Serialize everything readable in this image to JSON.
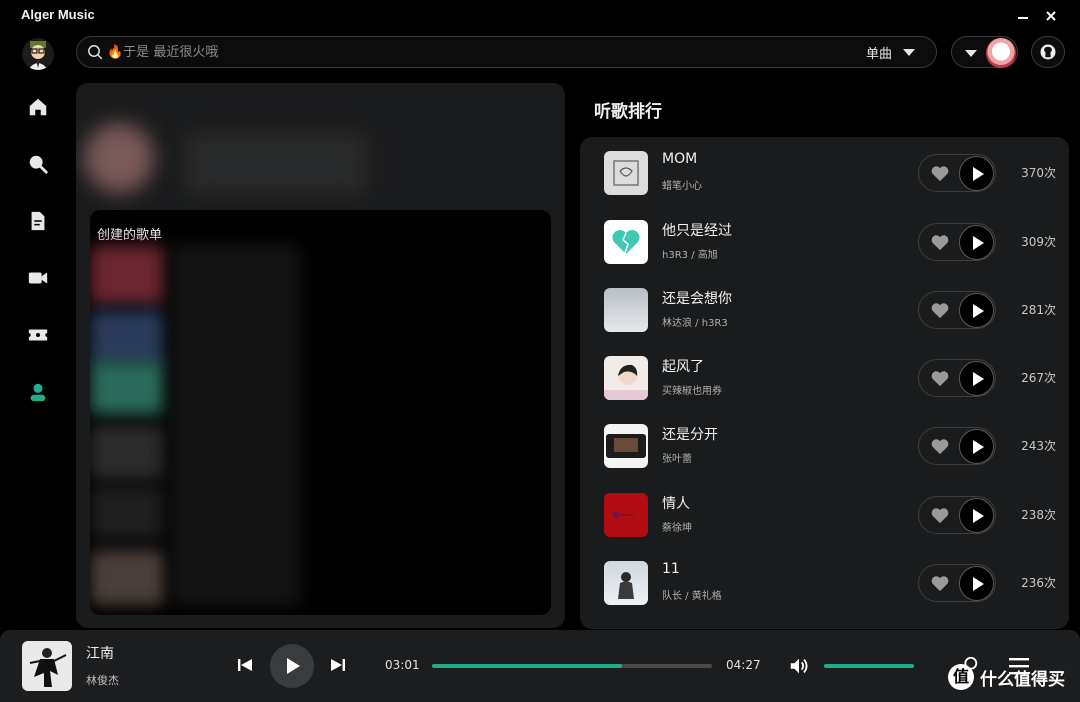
{
  "app": {
    "title": "Alger Music"
  },
  "search": {
    "placeholder": "🔥于是 最近很火哦",
    "type_label": "单曲"
  },
  "left_panel": {
    "playlist_title": "创建的歌单"
  },
  "ranking": {
    "title": "听歌排行",
    "items": [
      {
        "name": "MOM",
        "artist": "蜡笔小心",
        "count": "370次"
      },
      {
        "name": "他只是经过",
        "artist": "h3R3 / 高旭",
        "count": "309次"
      },
      {
        "name": "还是会想你",
        "artist": "林达浪 / h3R3",
        "count": "281次"
      },
      {
        "name": "起风了",
        "artist": "买辣椒也用券",
        "count": "267次"
      },
      {
        "name": "还是分开",
        "artist": "张叶蕾",
        "count": "243次"
      },
      {
        "name": "情人",
        "artist": "蔡徐坤",
        "count": "238次"
      },
      {
        "name": "11",
        "artist": "队长 / 黄礼格",
        "count": "236次"
      }
    ]
  },
  "player": {
    "title": "江南",
    "artist": "林俊杰",
    "current_time": "03:01",
    "total_time": "04:27",
    "progress": 0.68,
    "volume": 1.0
  },
  "watermark": {
    "badge": "值",
    "text": "什么值得买"
  },
  "colors": {
    "accent": "#1fae8c",
    "background": "#000000",
    "panel": "#1a1b1c"
  }
}
